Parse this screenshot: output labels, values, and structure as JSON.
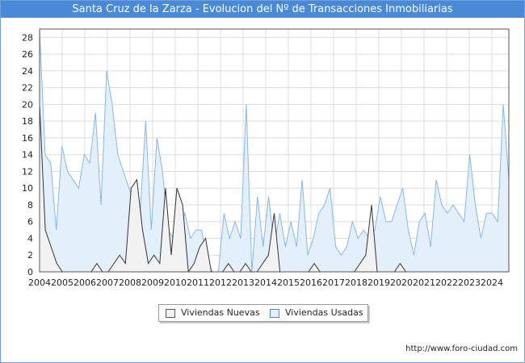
{
  "title": "Santa Cruz de la Zarza - Evolucion del Nº de Transacciones Inmobiliarias",
  "source": "http://www.foro-ciudad.com",
  "colors": {
    "title_bg": "#4a89d6",
    "nuevas_fill": "#f2f2f2",
    "nuevas_line": "#333333",
    "usadas_fill": "#e3f0fc",
    "usadas_line": "#8ab7e6"
  },
  "chart_data": {
    "type": "area",
    "title": "Santa Cruz de la Zarza - Evolucion del Nº de Transacciones Inmobiliarias",
    "xlabel": "",
    "ylabel": "",
    "ylim": [
      0,
      29
    ],
    "yticks": [
      0,
      2,
      4,
      6,
      8,
      10,
      12,
      14,
      16,
      18,
      20,
      22,
      24,
      26,
      28
    ],
    "x_range": [
      2004,
      2024.75
    ],
    "xticks": [
      2004,
      2005,
      2006,
      2007,
      2008,
      2009,
      2010,
      2011,
      2012,
      2013,
      2014,
      2015,
      2016,
      2017,
      2018,
      2019,
      2020,
      2021,
      2022,
      2023,
      2024
    ],
    "grid": true,
    "legend_position": "bottom-center",
    "x_units": "year (quarterly samples)",
    "series": [
      {
        "name": "Viviendas Nuevas",
        "values": [
          20,
          5,
          3,
          1,
          0,
          0,
          0,
          0,
          0,
          0,
          1,
          0,
          0,
          1,
          2,
          1,
          10,
          11,
          5,
          1,
          2,
          1,
          10,
          2,
          10,
          8,
          0,
          1,
          3,
          4,
          0,
          0,
          0,
          1,
          0,
          0,
          1,
          0,
          0,
          1,
          2,
          7,
          0,
          0,
          0,
          0,
          0,
          0,
          1,
          0,
          0,
          0,
          0,
          0,
          0,
          0,
          1,
          2,
          8,
          0,
          0,
          0,
          0,
          1,
          0,
          0,
          0,
          0,
          0,
          0,
          0,
          0,
          0,
          0,
          0,
          0,
          0,
          0,
          0,
          0,
          0,
          0,
          0
        ]
      },
      {
        "name": "Viviendas Usadas",
        "values": [
          29,
          14,
          13,
          5,
          15,
          12,
          11,
          10,
          14,
          13,
          19,
          8,
          24,
          20,
          14,
          12,
          10,
          8,
          7,
          18,
          5,
          16,
          12,
          5,
          4,
          5,
          7,
          4,
          5,
          5,
          1,
          0,
          0,
          7,
          4,
          6,
          4,
          20,
          0,
          9,
          3,
          9,
          3,
          7,
          3,
          6,
          3,
          11,
          2,
          4,
          7,
          8,
          10,
          3,
          2,
          3,
          6,
          4,
          5,
          4,
          5,
          9,
          6,
          6,
          8,
          10,
          5,
          2,
          6,
          7,
          3,
          11,
          8,
          7,
          8,
          7,
          6,
          14,
          8,
          4,
          7,
          7,
          6,
          20,
          11
        ]
      }
    ]
  },
  "legend": {
    "items": [
      {
        "label": "Viviendas Nuevas"
      },
      {
        "label": "Viviendas Usadas"
      }
    ]
  }
}
